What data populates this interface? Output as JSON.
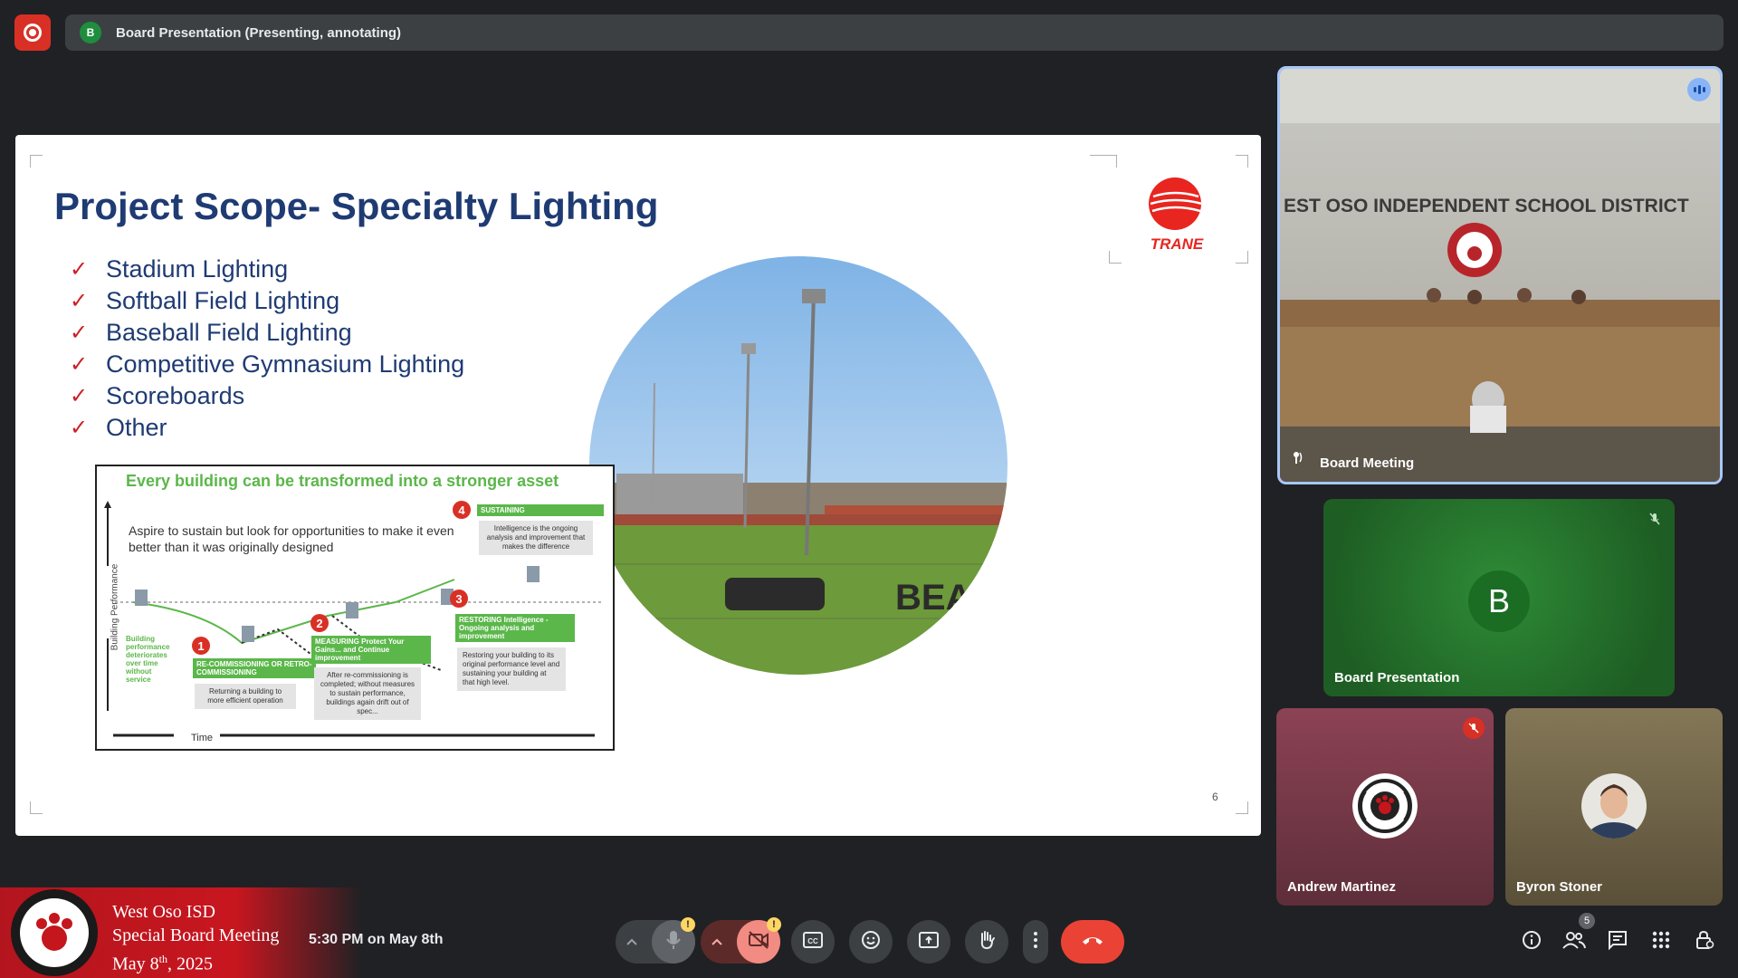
{
  "header": {
    "presenter_initial": "B",
    "title": "Board Presentation (Presenting, annotating)"
  },
  "slide": {
    "title": "Project Scope- Specialty Lighting",
    "logo_text": "TRANE",
    "bullets": [
      "Stadium Lighting",
      "Softball Field Lighting",
      "Baseball Field Lighting",
      "Competitive Gymnasium Lighting",
      "Scoreboards",
      "Other"
    ],
    "photo_sign_text": "BEAR",
    "page_number": "6",
    "diagram": {
      "heading": "Every building can be transformed into a stronger asset",
      "aspire": "Aspire to sustain but look for opportunities to make it even better than it was originally designed",
      "y_label": "Building Performance",
      "x_label": "Time",
      "left_note": "Building performance deteriorates over time without service",
      "steps": [
        {
          "num": "1",
          "title": "RE-COMMISSIONING OR RETRO-COMMISSIONING",
          "desc": "Returning a building to more efficient operation"
        },
        {
          "num": "2",
          "title": "MEASURING Protect Your Gains... and Continue improvement",
          "desc": "After re-commissioning is completed; without measures to sustain performance, buildings again drift out of spec..."
        },
        {
          "num": "3",
          "title": "RESTORING Intelligence - Ongoing analysis and improvement",
          "desc": "Restoring your building to its original performance level and sustaining your building at that high level."
        },
        {
          "num": "4",
          "title": "SUSTAINING",
          "desc": "Intelligence is the ongoing analysis and improvement that makes the difference"
        }
      ]
    }
  },
  "participants": {
    "room": {
      "name": "Board Meeting",
      "sign_text": "EST OSO INDEPENDENT SCHOOL DISTRICT"
    },
    "presentation": {
      "name": "Board Presentation",
      "initial": "B"
    },
    "andrew": {
      "name": "Andrew Martinez"
    },
    "byron": {
      "name": "Byron Stoner"
    }
  },
  "lower_third": {
    "line1": "West Oso ISD",
    "line2": "Special Board Meeting",
    "line3_prefix": "May 8",
    "line3_sup": "th",
    "line3_suffix": ", 2025"
  },
  "clock": "5:30 PM on May 8th",
  "controls": {
    "warning_mark": "!",
    "people_count": "5",
    "icons": [
      "chevron-up-icon",
      "microphone-icon",
      "chevron-up-icon",
      "camera-off-icon",
      "captions-icon",
      "emoji-icon",
      "present-screen-icon",
      "raise-hand-icon",
      "more-options-icon",
      "end-call-icon"
    ],
    "right_icons": [
      "info-icon",
      "people-icon",
      "chat-icon",
      "activities-icon",
      "host-controls-icon"
    ]
  },
  "colors": {
    "background": "#202124",
    "slide_title": "#1f3b73",
    "check": "#cc2027",
    "green": "#5bb74a",
    "end_call": "#d93025",
    "active_border": "#a8c7fa"
  }
}
